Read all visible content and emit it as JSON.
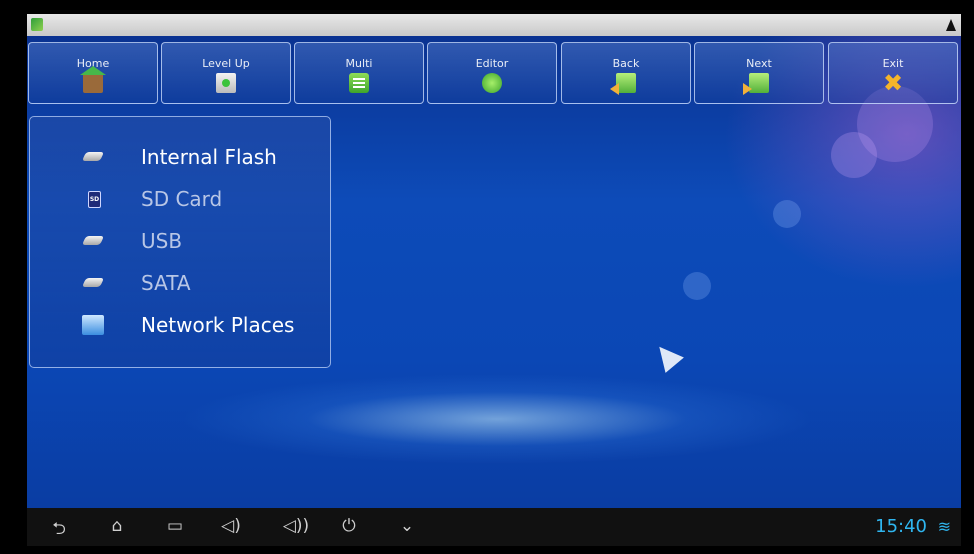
{
  "colors": {
    "accent": "#2fb6f0",
    "toolbar_border": "#d2e1ff",
    "desktop": "#0d4bb8"
  },
  "toolbar": {
    "buttons": [
      {
        "label": "Home",
        "icon": "home-icon"
      },
      {
        "label": "Level Up",
        "icon": "level-up-icon"
      },
      {
        "label": "Multi",
        "icon": "multi-icon"
      },
      {
        "label": "Editor",
        "icon": "editor-icon"
      },
      {
        "label": "Back",
        "icon": "back-icon"
      },
      {
        "label": "Next",
        "icon": "next-icon"
      },
      {
        "label": "Exit",
        "icon": "exit-icon"
      }
    ]
  },
  "storage": {
    "items": [
      {
        "label": "Internal Flash",
        "icon": "drive-icon"
      },
      {
        "label": "SD Card",
        "icon": "sd-card-icon"
      },
      {
        "label": "USB",
        "icon": "drive-icon"
      },
      {
        "label": "SATA",
        "icon": "drive-icon"
      },
      {
        "label": "Network Places",
        "icon": "network-icon"
      }
    ],
    "sd_icon_text": "SD"
  },
  "navbar": {
    "back": "⮌",
    "home": "⌂",
    "recents": "▭",
    "vol_down": "◁)",
    "vol_up": "◁))",
    "power": "⏻",
    "more": "⌄",
    "time": "15:40",
    "wifi": "≋"
  },
  "exit_glyph": "✖"
}
